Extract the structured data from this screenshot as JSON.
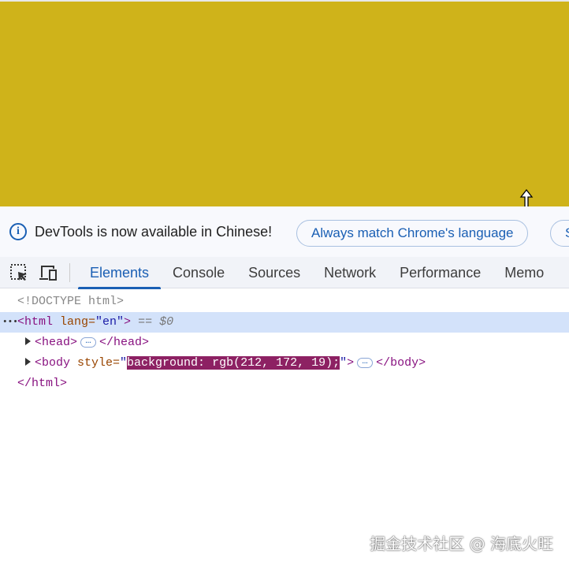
{
  "page": {
    "background": "#cfb31a"
  },
  "infobar": {
    "message": "DevTools is now available in Chinese!",
    "button": "Always match Chrome's language",
    "button2_partial": "S"
  },
  "tabs": [
    "Elements",
    "Console",
    "Sources",
    "Network",
    "Performance",
    "Memo"
  ],
  "dom": {
    "doctype": "<!DOCTYPE html>",
    "html_open": "<html",
    "lang_attr": " lang=",
    "lang_val": "\"en\"",
    "html_close_bracket": ">",
    "selected_ref": " == $0",
    "head_open": "<head>",
    "head_close": "</head>",
    "body_open": "<body",
    "style_attr": " style=",
    "quote": "\"",
    "style_val": "background: rgb(212, 172, 19);",
    "body_gt": ">",
    "body_close": "</body>",
    "html_close": "</html>",
    "ellipsis": "…",
    "dots": "•••"
  },
  "watermark": "掘金技术社区 @ 海底火旺"
}
